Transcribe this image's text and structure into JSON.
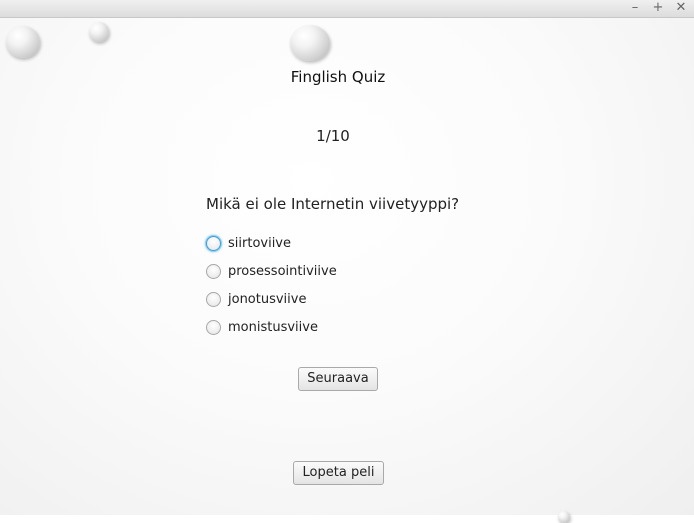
{
  "window": {
    "controls": {
      "minimize": "–",
      "maximize": "+",
      "close": "✕"
    }
  },
  "quiz": {
    "title": "Finglish Quiz",
    "progress": "1/10",
    "question": "Mikä ei ole Internetin viivetyyppi?",
    "options": [
      {
        "label": "siirtoviive",
        "selected": false,
        "focused": true
      },
      {
        "label": "prosessointiviive",
        "selected": false,
        "focused": false
      },
      {
        "label": "jonotusviive",
        "selected": false,
        "focused": false
      },
      {
        "label": "monistusviive",
        "selected": false,
        "focused": false
      }
    ],
    "next_label": "Seuraava",
    "quit_label": "Lopeta peli"
  },
  "colors": {
    "focus_ring": "#3a9bd6",
    "button_border": "#a9a9a9",
    "background": "#fbfbfb"
  }
}
